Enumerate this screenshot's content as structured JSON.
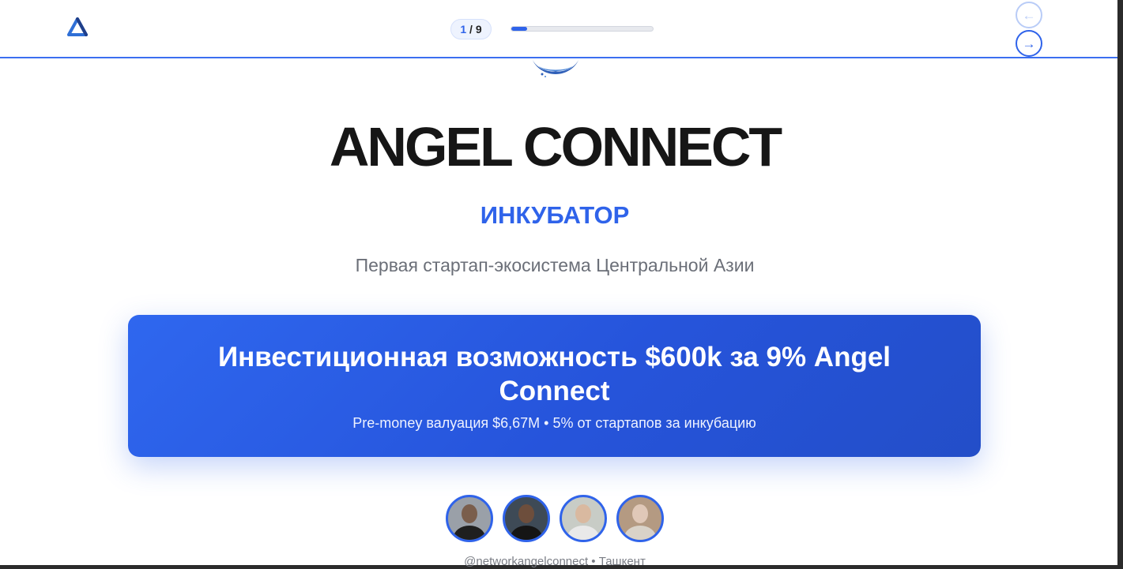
{
  "header": {
    "logo_icon": "triangle-logo-icon",
    "counter": {
      "current": "1",
      "separator": " / ",
      "total": "9"
    },
    "progress_fraction": 0.11,
    "prev_label": "←",
    "next_label": "→"
  },
  "hero": {
    "emblem_icon": "angel-wings-emblem-icon",
    "title": "ANGEL CONNECT",
    "subtitle": "ИНКУБАТОР",
    "tagline": "Первая стартап-экосистема Центральной Азии"
  },
  "card": {
    "title": "Инвестиционная возможность $600k за 9% Angel Connect",
    "subtitle": "Pre-money валуация $6,67M • 5% от стартапов за инкубацию"
  },
  "team": {
    "avatars": [
      {
        "name": "avatar-1",
        "bg": "#9aa0a8",
        "head": "#7a5e4c",
        "body": "#1f1f1f"
      },
      {
        "name": "avatar-2",
        "bg": "#3e4a56",
        "head": "#6d4e3c",
        "body": "#151515"
      },
      {
        "name": "avatar-3",
        "bg": "#c8ccc6",
        "head": "#d9b9a0",
        "body": "#e9e9e9"
      },
      {
        "name": "avatar-4",
        "bg": "#b49a82",
        "head": "#e0c8b8",
        "body": "#d9d2c8"
      }
    ],
    "footer": "@networkangelconnect • Ташкент"
  },
  "colors": {
    "accent": "#2f63ea",
    "title": "#161616",
    "muted": "#6b6f78"
  }
}
